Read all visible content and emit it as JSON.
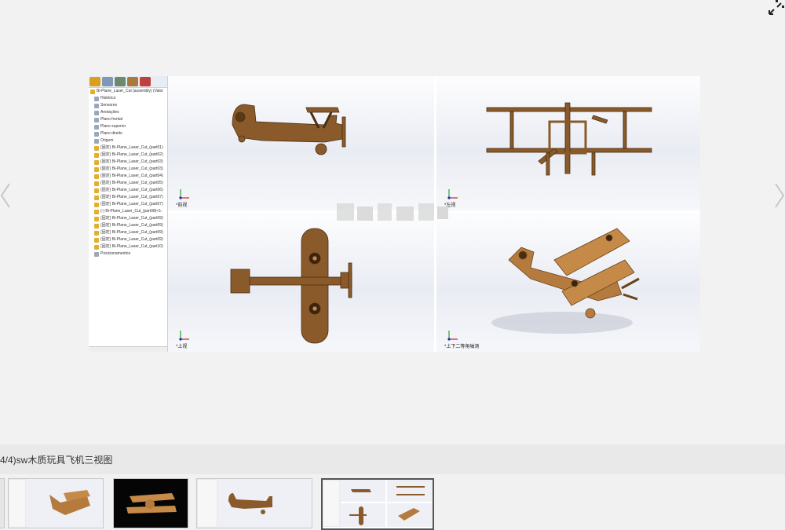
{
  "viewer": {
    "feature_tree": {
      "items": [
        "Bi-Plane_Laser_Cut (assembly) (Valor",
        "Histórico",
        "Sensores",
        "Anotações",
        "Plano frontal",
        "Plano superior",
        "Plano direito",
        "Origem",
        "(固定) Bi-Plane_Laser_Cut_(part01)",
        "(固定) Bi-Plane_Laser_Cut_(part02)",
        "(固定) Bi-Plane_Laser_Cut_(part03)",
        "(固定) Bi-Plane_Laser_Cut_(part03)",
        "(固定) Bi-Plane_Laser_Cut_(part04)",
        "(固定) Bi-Plane_Laser_Cut_(part05)",
        "(固定) Bi-Plane_Laser_Cut_(part06)",
        "(固定) Bi-Plane_Laser_Cut_(part07)",
        "(固定) Bi-Plane_Laser_Cut_(part07)",
        "(-) Bi-Plane_Laser_Cut_(part08)<1-",
        "(固定) Bi-Plane_Laser_Cut_(part09)",
        "(固定) Bi-Plane_Laser_Cut_(part09)",
        "(固定) Bi-Plane_Laser_Cut_(part09)",
        "(固定) Bi-Plane_Laser_Cut_(part09)",
        "(固定) Bi-Plane_Laser_Cut_(part10)",
        "Posicionamentos"
      ]
    },
    "views": [
      {
        "label": "*前视"
      },
      {
        "label": "*左视"
      },
      {
        "label": "*上视"
      },
      {
        "label": "*上下二等角轴测"
      }
    ]
  },
  "caption": "4/4)sw木质玩具飞机三视图",
  "icons": {
    "fullscreen": "exit-fullscreen-icon",
    "prev": "chevron-left-icon",
    "next": "chevron-right-icon"
  },
  "colors": {
    "wood": "#8a5a2b",
    "wood_light": "#c58a48",
    "tree_icon": "#e0b030"
  }
}
